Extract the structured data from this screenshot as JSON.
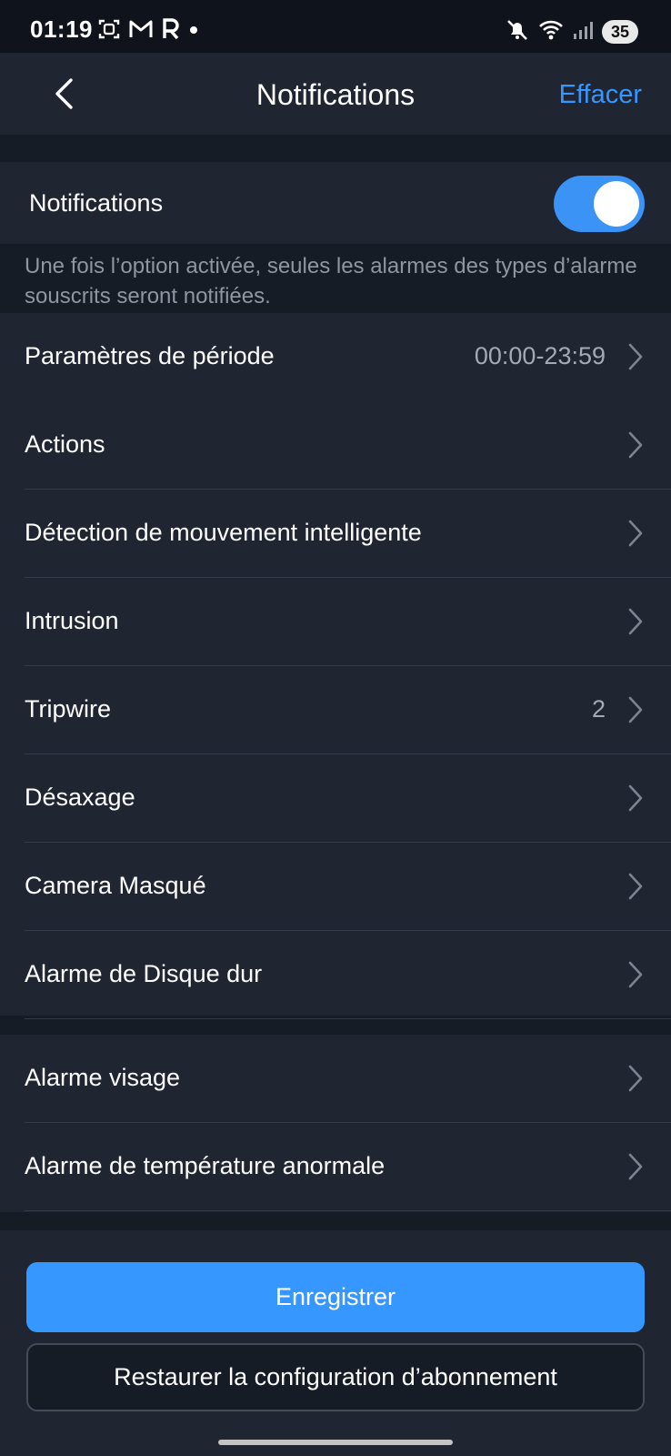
{
  "status_bar": {
    "time": "01:19",
    "left_icons": [
      "screenshot-icon",
      "gmail-icon",
      "r-app-icon",
      "dot-icon"
    ],
    "right_icons": [
      "mute-icon",
      "wifi-icon",
      "signal-icon"
    ],
    "battery": "35"
  },
  "header": {
    "back_icon": "chevron-left-icon",
    "title": "Notifications",
    "clear_label": "Effacer"
  },
  "notifications_toggle": {
    "label": "Notifications",
    "enabled": true,
    "hint": "Une fois l’option activée, seules les alarmes des types d’alarme souscrits seront notifiées."
  },
  "alarm_groups": [
    {
      "items": [
        {
          "label": "Paramètres de période",
          "value": "00:00-23:59"
        },
        {
          "label": "Actions",
          "value": ""
        },
        {
          "label": "Détection de mouvement intelligente",
          "value": ""
        },
        {
          "label": "Intrusion",
          "value": ""
        },
        {
          "label": "Tripwire",
          "value": "2"
        },
        {
          "label": "Désaxage",
          "value": ""
        },
        {
          "label": "Camera Masqué",
          "value": ""
        },
        {
          "label": "Alarme de Disque dur",
          "value": ""
        }
      ]
    },
    {
      "items": [
        {
          "label": "Alarme visage",
          "value": ""
        },
        {
          "label": "Alarme de température anormale",
          "value": ""
        }
      ]
    }
  ],
  "buttons": {
    "save_label": "Enregistrer",
    "restore_label": "Restaurer la configuration d’abonnement"
  },
  "colors": {
    "accent": "#3597ff",
    "background": "#161c26",
    "card": "#1f2632",
    "muted_text": "#8e96a2"
  }
}
